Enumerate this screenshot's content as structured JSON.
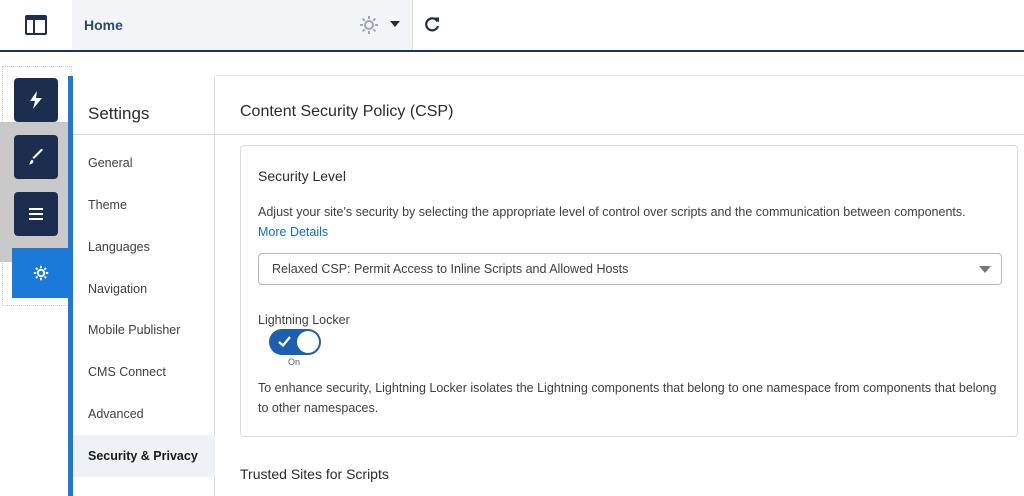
{
  "header": {
    "page_tab_title": "Home"
  },
  "settings": {
    "title": "Settings",
    "nav_items": [
      {
        "label": "General"
      },
      {
        "label": "Theme"
      },
      {
        "label": "Languages"
      },
      {
        "label": "Navigation"
      },
      {
        "label": "Mobile Publisher"
      },
      {
        "label": "CMS Connect"
      },
      {
        "label": "Advanced"
      },
      {
        "label": "Security & Privacy"
      }
    ],
    "selected_index": 7
  },
  "main": {
    "title": "Content Security Policy (CSP)",
    "security_level": {
      "heading": "Security Level",
      "description": "Adjust your site's security by selecting the appropriate level of control over scripts and the communication between components.",
      "more_link": "More Details",
      "selected_option": "Relaxed CSP: Permit Access to Inline Scripts and Allowed Hosts"
    },
    "lightning_locker": {
      "label": "Lightning Locker",
      "state": "On",
      "description": "To enhance security, Lightning Locker isolates the Lightning components that belong to one namespace from components that belong to other namespaces."
    },
    "trusted_sites_heading": "Trusted Sites for Scripts"
  },
  "colors": {
    "accent": "#1b79d9",
    "rail_dark": "#1d2d50",
    "link": "#0b6fce",
    "toggle_on": "#1b5fb0"
  },
  "icons": {
    "app_launcher": "layout-icon",
    "page_settings": "gear-icon",
    "refresh": "refresh-icon",
    "rail": [
      "lightning-icon",
      "paintbrush-icon",
      "list-icon",
      "gear-icon"
    ]
  }
}
